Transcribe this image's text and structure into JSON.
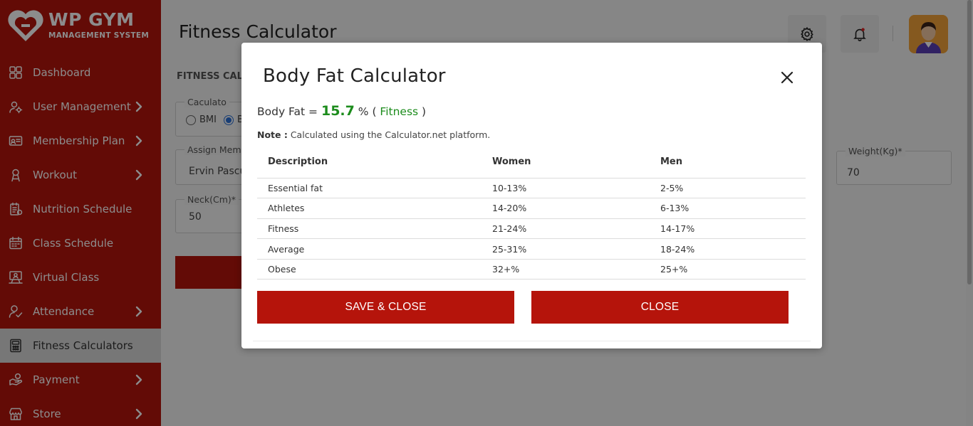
{
  "brand": {
    "title": "WP GYM",
    "subtitle": "MANAGEMENT SYSTEM"
  },
  "sidebar": {
    "items": [
      {
        "label": "Dashboard",
        "icon": "dashboard-icon",
        "has_chevron": false
      },
      {
        "label": "User Management",
        "icon": "user-gear-icon",
        "has_chevron": true
      },
      {
        "label": "Membership Plan",
        "icon": "membership-card-icon",
        "has_chevron": true
      },
      {
        "label": "Workout",
        "icon": "workout-icon",
        "has_chevron": true
      },
      {
        "label": "Nutrition Schedule",
        "icon": "nutrition-icon",
        "has_chevron": false
      },
      {
        "label": "Class Schedule",
        "icon": "calendar-icon",
        "has_chevron": false
      },
      {
        "label": "Virtual Class",
        "icon": "virtual-class-icon",
        "has_chevron": false
      },
      {
        "label": "Attendance",
        "icon": "attendance-icon",
        "has_chevron": true
      },
      {
        "label": "Fitness Calculators",
        "icon": "calculator-icon",
        "has_chevron": false,
        "active": true
      },
      {
        "label": "Payment",
        "icon": "payment-icon",
        "has_chevron": true
      },
      {
        "label": "Store",
        "icon": "store-icon",
        "has_chevron": true
      }
    ]
  },
  "header": {
    "title": "Fitness Calculator"
  },
  "background_form": {
    "section_label": "FITNESS CALC",
    "calculator_legend": "Caculato",
    "radio_bmi": "BMI",
    "radio_b": "B",
    "assign_member_legend": "Assign Mem",
    "assign_member_value": "Ervin Pascu",
    "weight_legend": "Weight(Kg)*",
    "weight_value": "70",
    "neck_legend": "Neck(Cm)*",
    "neck_value": "50"
  },
  "modal": {
    "title": "Body Fat Calculator",
    "result_prefix": "Body Fat = ",
    "result_value": "15.7",
    "result_unit": " % ( ",
    "result_category": "Fitness",
    "result_suffix": " )",
    "note_label": "Note :",
    "note_text": " Calculated using the Calculator.net platform.",
    "table": {
      "headers": [
        "Description",
        "Women",
        "Men"
      ],
      "rows": [
        [
          "Essential fat",
          "10-13%",
          "2-5%"
        ],
        [
          "Athletes",
          "14-20%",
          "6-13%"
        ],
        [
          "Fitness",
          "21-24%",
          "14-17%"
        ],
        [
          "Average",
          "25-31%",
          "18-24%"
        ],
        [
          "Obese",
          "32+%",
          "25+%"
        ]
      ]
    },
    "save_button": "SAVE & CLOSE",
    "close_button": "CLOSE"
  },
  "colors": {
    "brand_red": "#b5140b",
    "result_green": "#1c8c1c",
    "active_nav": "#d9d9d9"
  }
}
